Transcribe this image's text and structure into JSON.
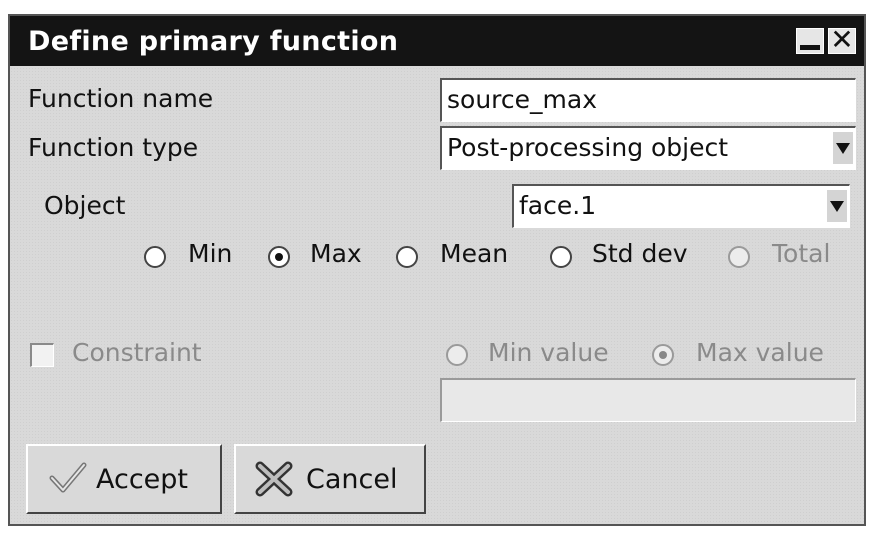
{
  "window": {
    "title": "Define primary function"
  },
  "function_name": {
    "label": "Function name",
    "value": "source_max"
  },
  "function_type": {
    "label": "Function type",
    "value": "Post-processing object"
  },
  "object": {
    "label": "Object",
    "value": "face.1"
  },
  "stats": {
    "options": [
      {
        "label": "Min",
        "selected": false,
        "enabled": true
      },
      {
        "label": "Max",
        "selected": true,
        "enabled": true
      },
      {
        "label": "Mean",
        "selected": false,
        "enabled": true
      },
      {
        "label": "Std dev",
        "selected": false,
        "enabled": true
      },
      {
        "label": "Total",
        "selected": false,
        "enabled": false
      }
    ]
  },
  "constraint": {
    "label": "Constraint",
    "checked": false,
    "enabled": false,
    "min_value_label": "Min value",
    "max_value_label": "Max value",
    "selected": "Max value",
    "value": ""
  },
  "buttons": {
    "accept": "Accept",
    "cancel": "Cancel"
  },
  "icons": {
    "accept": "checkmark-icon",
    "cancel": "cross-icon"
  }
}
